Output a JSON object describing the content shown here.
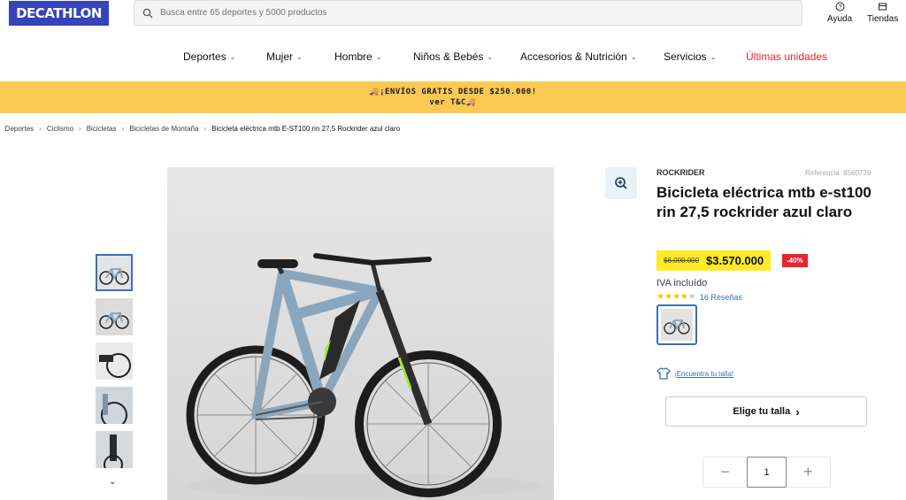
{
  "header": {
    "logo": "DECATHLON",
    "search_placeholder": "Busca entre 65 deportes y 5000 productos",
    "help_label": "Ayuda",
    "stores_label": "Tiendas"
  },
  "nav": {
    "items": [
      {
        "label": "Deportes"
      },
      {
        "label": "Mujer"
      },
      {
        "label": "Hombre"
      },
      {
        "label": "Niños & Bebés"
      },
      {
        "label": "Accesorios & Nutrición"
      },
      {
        "label": "Servicios"
      },
      {
        "label": "Últimas unidades"
      }
    ]
  },
  "banner": {
    "line1": "¡ENVÍOS GRATIS DESDE $250.000!",
    "line2": "ver T&C"
  },
  "breadcrumb": {
    "items": [
      "Deportes",
      "Ciclismo",
      "Bicicletas",
      "Bicicletas de Montaña",
      "Bicicleta eléctrica mtb E-ST100 rin 27,5 Rockrider azul claro"
    ]
  },
  "product": {
    "brand": "ROCKRIDER",
    "reference": "Referencia: 8560739",
    "title": "Bicicleta eléctrica mtb e-st100 rin 27,5 rockrider azul claro",
    "old_price": "$6.000.000",
    "new_price": "$3.570.000",
    "discount": "-40%",
    "tax_note": "IVA incluído",
    "rating": 4,
    "reviews": "16 Reseñas",
    "size_link": "¡Encuentra tu talla!",
    "size_button": "Elige tu talla",
    "quantity": "1"
  },
  "colors": {
    "brand_blue": "#3643ba",
    "banner_yellow": "#fbc952",
    "price_yellow": "#ffea28",
    "discount_red": "#e3262f",
    "link_blue": "#3b6fb6"
  }
}
